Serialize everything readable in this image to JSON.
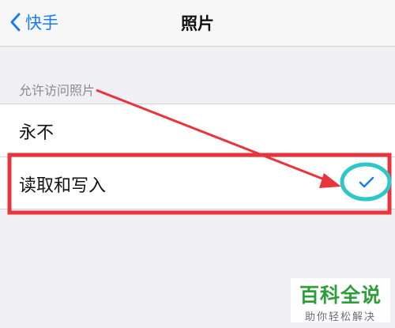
{
  "navbar": {
    "back_label": "快手",
    "title": "照片"
  },
  "section": {
    "header": "允许访问照片",
    "options": [
      {
        "label": "永不",
        "selected": false
      },
      {
        "label": "读取和写入",
        "selected": true
      }
    ]
  },
  "watermark": {
    "title": "百科全说",
    "subtitle": "助你轻松解决"
  },
  "colors": {
    "accent": "#1a7cf5",
    "annotation_red": "#e8343a",
    "annotation_circle": "#2ec7c9",
    "watermark_green": "#2e9e3b"
  },
  "icons": {
    "back": "chevron-left-icon",
    "selected": "checkmark-icon"
  }
}
